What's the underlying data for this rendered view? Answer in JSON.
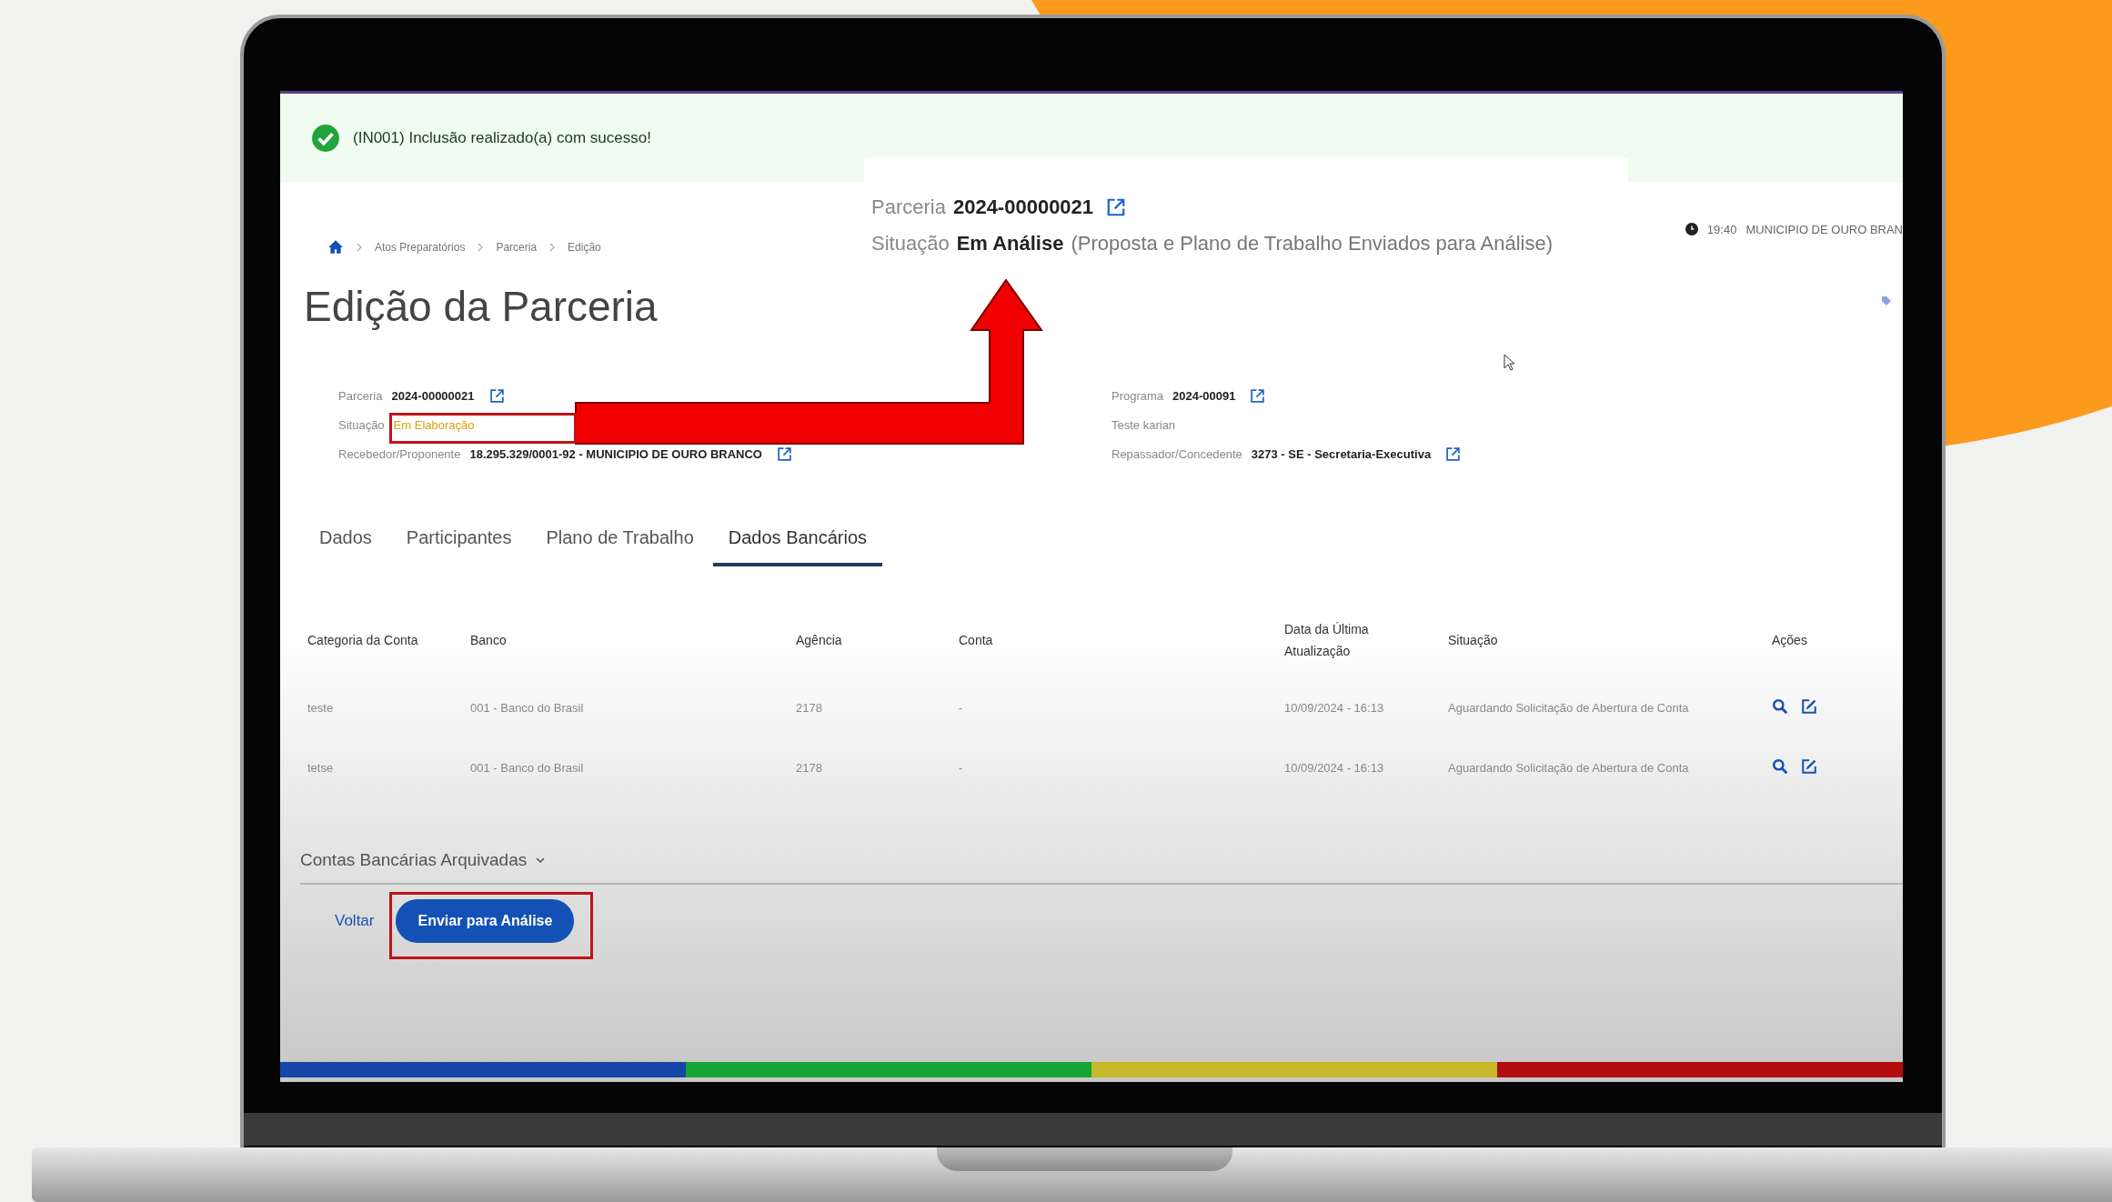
{
  "notification": {
    "text": "(IN001) Inclusão realizado(a) com sucesso!"
  },
  "callout": {
    "rows": [
      {
        "kind": "link",
        "label": "Parceria",
        "value": "2024-00000021"
      },
      {
        "kind": "status",
        "label": "Situação",
        "value": "Em Análise",
        "note": "(Proposta e Plano de Trabalho Enviados para Análise)"
      }
    ]
  },
  "breadcrumb": [
    "Atos Preparatórios",
    "Parceria",
    "Edição"
  ],
  "session": {
    "time": "19:40",
    "municipality": "MUNICIPIO DE OURO BRAN"
  },
  "title": "Edição da Parceria",
  "details_left": [
    {
      "kind": "link",
      "label": "Parceria",
      "value": "2024-00000021"
    },
    {
      "kind": "status",
      "label": "Situação",
      "value": "Em Elaboração"
    },
    {
      "kind": "link",
      "label": "Recebedor/Proponente",
      "value": "18.295.329/0001-92 - MUNICIPIO DE OURO BRANCO"
    }
  ],
  "details_right": [
    {
      "kind": "link",
      "label": "Programa",
      "value": "2024-00091"
    },
    {
      "kind": "text",
      "label": "Teste karian"
    },
    {
      "kind": "link",
      "label": "Repassador/Concedente",
      "value": "3273 - SE - Secretaria-Executiva"
    }
  ],
  "tabs": [
    {
      "label": "Dados",
      "selected": false
    },
    {
      "label": "Participantes",
      "selected": false
    },
    {
      "label": "Plano de Trabalho",
      "selected": false
    },
    {
      "label": "Dados Bancários",
      "selected": true
    }
  ],
  "table": {
    "columns": [
      "Categoria da Conta",
      "Banco",
      "Agência",
      "Conta",
      "Data da Última Atualização",
      "Situação",
      "Ações"
    ],
    "rows": [
      [
        "teste",
        "001 - Banco do Brasil",
        "2178",
        "-",
        "10/09/2024 - 16:13",
        "Aguardando Solicitação de Abertura de Conta"
      ],
      [
        "tetse",
        "001 - Banco do Brasil",
        "2178",
        "-",
        "10/09/2024 - 16:13",
        "Aguardando Solicitação de Abertura de Conta"
      ]
    ]
  },
  "archived": {
    "label": "Contas Bancárias Arquivadas"
  },
  "actions": {
    "back": "Voltar",
    "submit": "Enviar para Análise"
  }
}
